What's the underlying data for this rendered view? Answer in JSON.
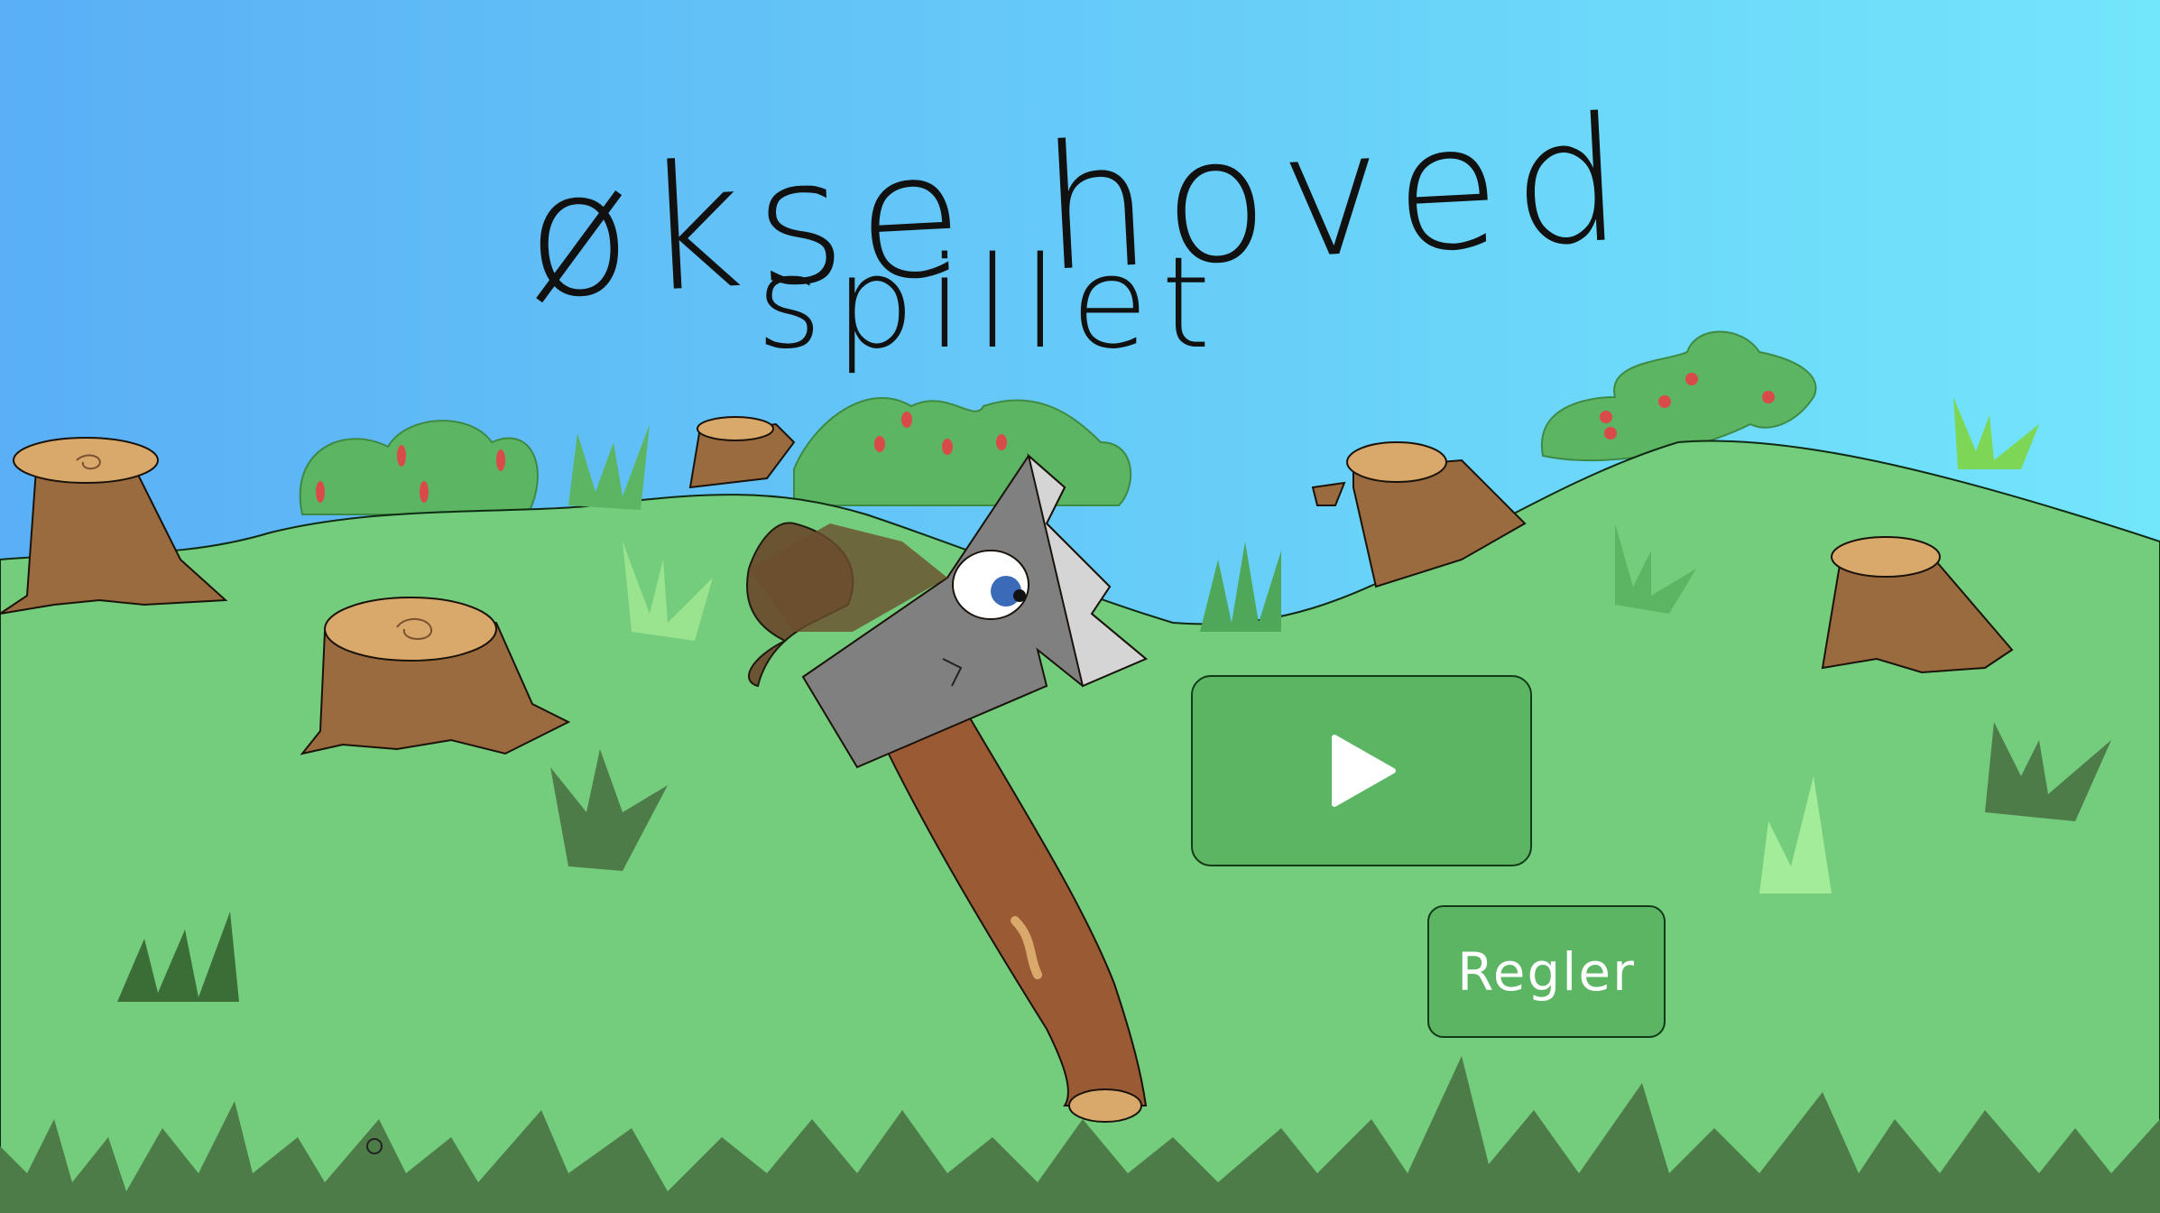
{
  "game": {
    "title_line1": "økse hoved",
    "title_line2": "spillet"
  },
  "menu": {
    "play_icon": "play-icon",
    "rules_label": "Regler"
  },
  "colors": {
    "sky_top": "#5aaff5",
    "sky_bottom": "#72e6fb",
    "grass": "#74cc7d",
    "grass_dark": "#4d7c49",
    "button_green": "#5cb563",
    "stump": "#9a6b3e",
    "stump_top": "#d9a96c",
    "axe_blade": "#808080",
    "axe_handle": "#9a5b34",
    "hat": "#6b4e2e"
  }
}
